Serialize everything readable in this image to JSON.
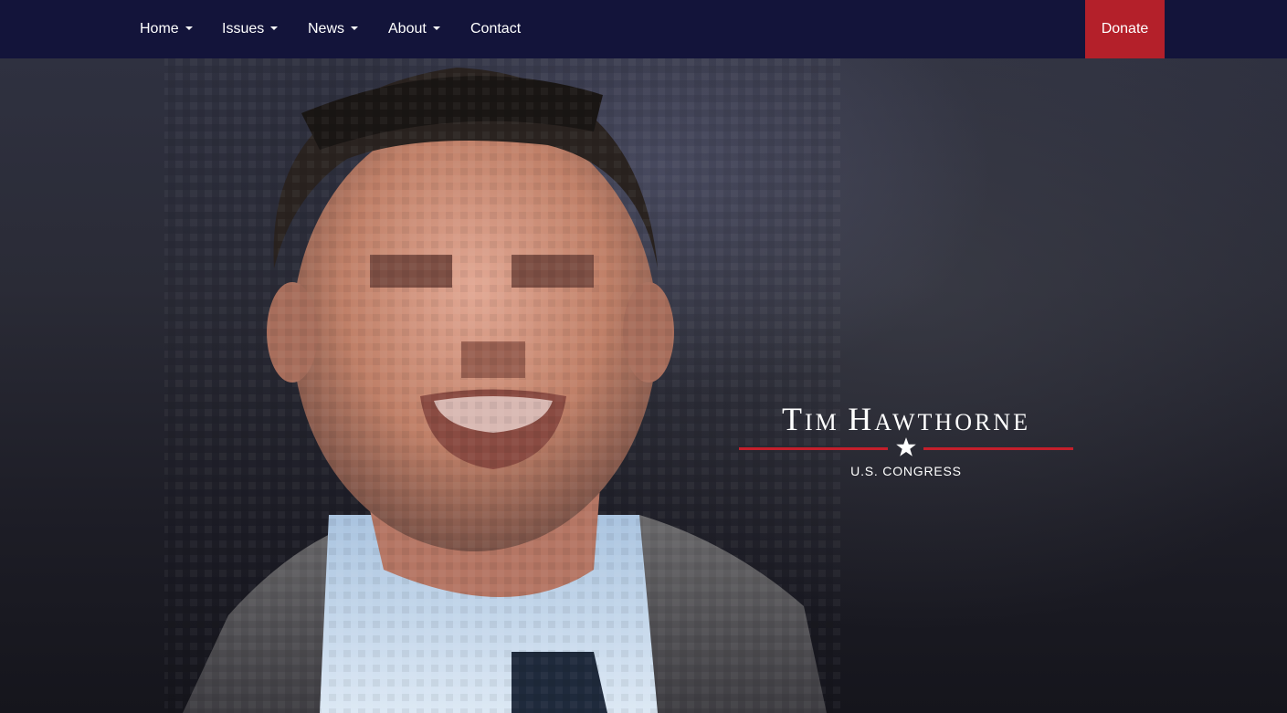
{
  "nav": {
    "items": [
      {
        "label": "Home",
        "has_dropdown": true
      },
      {
        "label": "Issues",
        "has_dropdown": true
      },
      {
        "label": "News",
        "has_dropdown": true
      },
      {
        "label": "About",
        "has_dropdown": true
      },
      {
        "label": "Contact",
        "has_dropdown": false
      }
    ],
    "donate_label": "Donate"
  },
  "hero": {
    "image": "pixelated-portrait-of-smiling-man-in-suit",
    "logo": {
      "name_first_initial": "T",
      "name_first_rest": "IM",
      "name_last_initial": "H",
      "name_last_rest": "AWTHORNE",
      "subtitle": "U.S. CONGRESS",
      "icon": "star-icon"
    }
  },
  "colors": {
    "navbar": "#13143a",
    "donate": "#b4202a",
    "accent_rule": "#c41f2b",
    "text": "#ffffff"
  }
}
